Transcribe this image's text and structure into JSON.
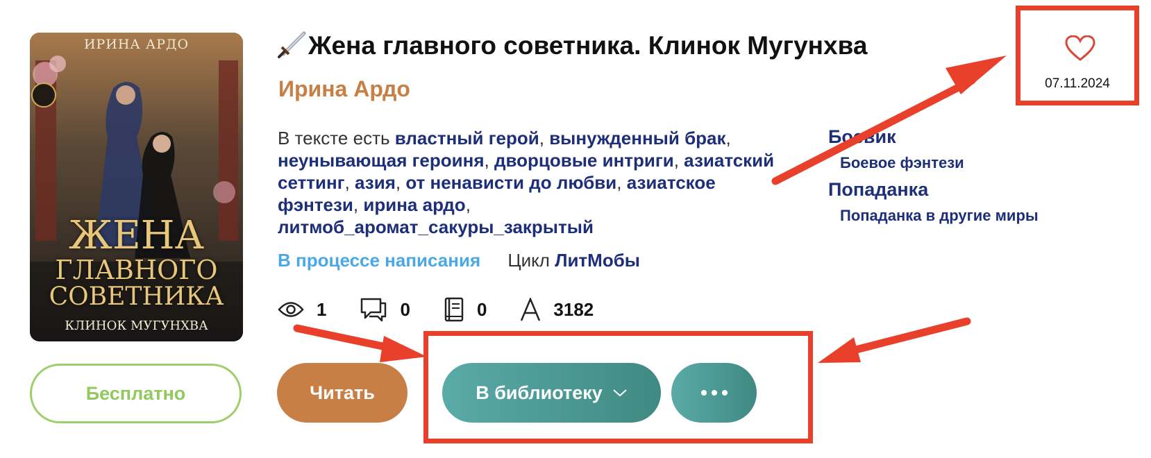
{
  "book": {
    "title": "Жена главного советника. Клинок Мугунхва",
    "author": "Ирина Ардо",
    "cover": {
      "author": "ИРИНА АРДО",
      "title_line1": "ЖЕНА",
      "title_line2": "ГЛАВНОГО",
      "title_line3": "СОВЕТНИКА",
      "subtitle": "КЛИНОК МУГУНХВА"
    }
  },
  "tags": {
    "prefix": "В тексте есть",
    "items": [
      "властный герой",
      "вынужденный брак",
      "неунывающая героиня",
      "дворцовые интриги",
      "азиатский сеттинг",
      "азия",
      "от ненависти до любви",
      "азиатское фэнтези",
      "ирина ардо",
      "литмоб_аромат_сакуры_закрытый"
    ]
  },
  "genres": [
    {
      "label": "Боевик",
      "sub": "Боевое фэнтези"
    },
    {
      "label": "Попаданка",
      "sub": "Попаданка в другие миры"
    }
  ],
  "status": {
    "label": "В процессе написания",
    "cycle_label": "Цикл",
    "cycle_name": "ЛитМобы"
  },
  "stats": {
    "views": "1",
    "comments": "0",
    "library": "0",
    "chars": "3182"
  },
  "buttons": {
    "free": "Бесплатно",
    "read": "Читать",
    "library": "В библиотеку"
  },
  "favorite": {
    "date": "07.11.2024"
  },
  "colors": {
    "accent_orange": "#c87f45",
    "link_blue": "#1e2f7a",
    "status_blue": "#4aa8e6",
    "free_green": "#92c95e",
    "teal": "#4a9a94",
    "annotation_red": "#e8402a"
  },
  "icons": [
    "sword-icon",
    "eye-icon",
    "comment-icon",
    "book-icon",
    "font-icon",
    "chevron-down-icon",
    "more-dots-icon",
    "heart-icon"
  ]
}
